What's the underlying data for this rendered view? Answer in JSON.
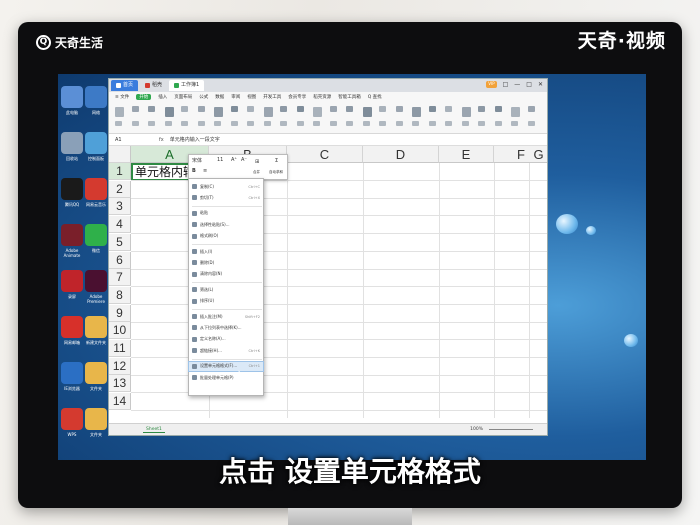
{
  "overlay": {
    "brand": "天奇生活",
    "brand_logo_char": "Q",
    "watermark": "天奇·视频"
  },
  "subtitle": "点击 设置单元格格式",
  "app": {
    "tabs": [
      {
        "label": "首页",
        "kind": "home"
      },
      {
        "label": "稻壳",
        "kind": "normal"
      },
      {
        "label": "工作簿1",
        "kind": "active"
      }
    ],
    "window_controls": [
      "□",
      "—",
      "□",
      "✕"
    ],
    "menu": [
      "≡ 文件",
      "开始",
      "插入",
      "页面布局",
      "公式",
      "数据",
      "审阅",
      "视图",
      "开发工具",
      "会员专享",
      "稻壳资源",
      "智能工具箱",
      "Q 查找"
    ],
    "active_menu_index": 1,
    "formula_bar": {
      "cell_ref": "A1",
      "fx": "fx",
      "content": "单元格内输入一段文字"
    },
    "columns": [
      "A",
      "B",
      "C",
      "D",
      "E",
      "F",
      "G"
    ],
    "rows": [
      "1",
      "2",
      "3",
      "4",
      "5",
      "6",
      "7",
      "8",
      "9",
      "10",
      "11",
      "12",
      "13",
      "14"
    ],
    "cell_a1": "单元格内输入一段文字",
    "sheet_tab": "Sheet1",
    "zoom": "100%"
  },
  "mini_toolbar": {
    "font": "宋体",
    "size": "11",
    "items": [
      "A⁺",
      "A⁻",
      "B",
      "≡",
      "⊞",
      "Σ",
      "合并",
      "自动求和"
    ]
  },
  "context_menu": [
    {
      "label": "复制(C)",
      "shortcut": "Ctrl+C"
    },
    {
      "label": "剪切(T)",
      "shortcut": "Ctrl+X"
    },
    {
      "label": "粘贴",
      "shortcut": ""
    },
    {
      "label": "选择性粘贴(S)...",
      "shortcut": ""
    },
    {
      "label": "格式刷(O)",
      "shortcut": ""
    },
    {
      "label": "插入(I)",
      "shortcut": ""
    },
    {
      "label": "删除(D)",
      "shortcut": ""
    },
    {
      "label": "清除内容(N)",
      "shortcut": ""
    },
    {
      "label": "筛选(L)",
      "shortcut": ""
    },
    {
      "label": "排序(U)",
      "shortcut": ""
    },
    {
      "label": "插入批注(M)",
      "shortcut": "Shift+F2"
    },
    {
      "label": "从下拉列表中选择(K)...",
      "shortcut": ""
    },
    {
      "label": "定义名称(A)...",
      "shortcut": ""
    },
    {
      "label": "超链接(H)...",
      "shortcut": "Ctrl+K"
    },
    {
      "label": "设置单元格格式(F)...",
      "shortcut": "Ctrl+1",
      "highlighted": true
    },
    {
      "label": "批量处理单元格(P)",
      "shortcut": ""
    }
  ],
  "desktop_icons": [
    {
      "label": "此电脑",
      "color": "#5b8fd6"
    },
    {
      "label": "网络",
      "color": "#3d7ac6"
    },
    {
      "label": "回收站",
      "color": "#8aa0b8"
    },
    {
      "label": "控制面板",
      "color": "#4fa0d8"
    },
    {
      "label": "腾讯QQ",
      "color": "#1a1a1a"
    },
    {
      "label": "网易云音乐",
      "color": "#d43a2f"
    },
    {
      "label": "Adobe Animate",
      "color": "#7a1f2a"
    },
    {
      "label": "微信",
      "color": "#2fb04a"
    },
    {
      "label": "录屏",
      "color": "#c0242a"
    },
    {
      "label": "Adobe Premiere",
      "color": "#4a1030"
    },
    {
      "label": "网易邮箱",
      "color": "#d7302a"
    },
    {
      "label": "新建文件夹",
      "color": "#e8b64a"
    },
    {
      "label": "IE浏览器",
      "color": "#2b6fc4"
    },
    {
      "label": "文件夹",
      "color": "#e8b64a"
    },
    {
      "label": "WPS",
      "color": "#d43a2f"
    },
    {
      "label": "文件夹",
      "color": "#e8b64a"
    }
  ]
}
